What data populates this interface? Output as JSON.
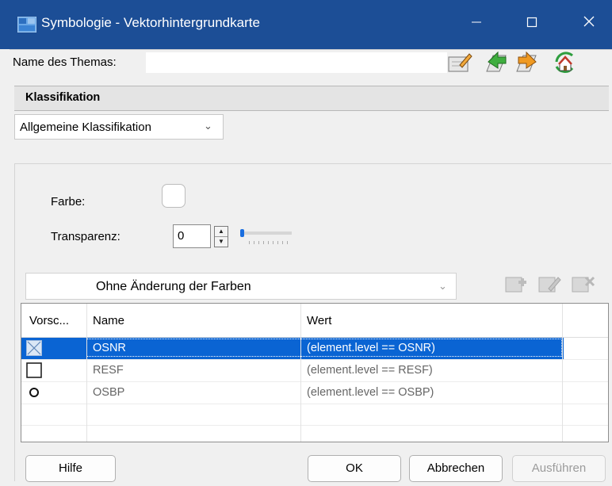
{
  "window": {
    "title": "Symbologie - Vektorhintergrundkarte",
    "controls": [
      "minimize",
      "maximize",
      "close"
    ]
  },
  "theme": {
    "name_label": "Name des Themas:",
    "name_value": "",
    "tools": [
      "edit-icon",
      "import-icon",
      "export-icon",
      "home-refresh-icon"
    ]
  },
  "classification": {
    "section_title": "Klassifikation",
    "type_selected": "Allgemeine Klassifikation"
  },
  "color": {
    "label": "Farbe:",
    "swatch_color": "#ffffff"
  },
  "transparency": {
    "label": "Transparenz:",
    "value": "0",
    "slider_fraction": 0
  },
  "color_mode": {
    "selected": "Ohne Änderung der Farben",
    "row_tools": [
      "add-row-icon",
      "edit-row-icon",
      "delete-row-icon"
    ]
  },
  "table": {
    "columns": [
      "Vorsc...",
      "Name",
      "Wert"
    ],
    "rows": [
      {
        "symbol": "x-cell",
        "name": "OSNR",
        "value": "(element.level == OSNR)",
        "selected": true
      },
      {
        "symbol": "square",
        "name": "RESF",
        "value": "(element.level == RESF)",
        "selected": false
      },
      {
        "symbol": "circle",
        "name": "OSBP",
        "value": "(element.level == OSBP)",
        "selected": false
      }
    ]
  },
  "buttons": {
    "help": "Hilfe",
    "ok": "OK",
    "cancel": "Abbrechen",
    "apply": "Ausführen"
  },
  "colors": {
    "titlebar": "#1c4e96",
    "selection": "#0a64d3"
  }
}
